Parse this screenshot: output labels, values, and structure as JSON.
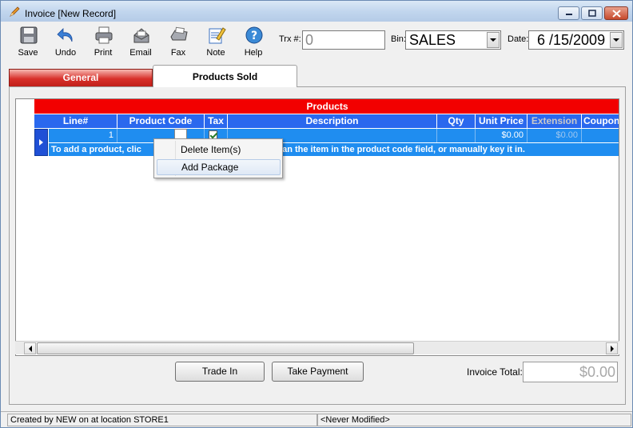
{
  "window": {
    "title": "Invoice [New Record]"
  },
  "toolbar": {
    "buttons": [
      {
        "label": "Save",
        "icon": "floppy-disk-icon"
      },
      {
        "label": "Undo",
        "icon": "undo-arrow-icon"
      },
      {
        "label": "Print",
        "icon": "printer-icon"
      },
      {
        "label": "Email",
        "icon": "email-icon"
      },
      {
        "label": "Fax",
        "icon": "fax-icon"
      },
      {
        "label": "Note",
        "icon": "note-pencil-icon"
      },
      {
        "label": "Help",
        "icon": "help-icon"
      }
    ]
  },
  "header": {
    "trx_label": "Trx #:",
    "trx_value": "0",
    "bin_label": "Bin:",
    "bin_value": "SALES",
    "date_label": "Date:",
    "date_value": "6 /15/2009"
  },
  "tabs": [
    {
      "label": "General",
      "active": false
    },
    {
      "label": "Products Sold",
      "active": true
    }
  ],
  "grid": {
    "band_title": "Products",
    "columns": [
      "Line#",
      "Product Code",
      "Tax",
      "Description",
      "Qty",
      "Unit Price",
      "Extension",
      "Coupon"
    ],
    "row": {
      "line": "1",
      "product_code": "",
      "tax": true,
      "description": "",
      "qty": "",
      "unit_price": "$0.00",
      "extension": "$0.00",
      "coupon": ""
    },
    "hint": "To add a product, click the product code field and scan the item in the product code field, or manually key it in.",
    "hint_left": "To add a product, clic",
    "hint_right": "scan the item in the product code field, or manually key it in."
  },
  "context_menu": {
    "items": [
      "Delete Item(s)",
      "Add Package"
    ]
  },
  "footer": {
    "trade_in_label": "Trade In",
    "take_payment_label": "Take Payment",
    "invoice_total_label": "Invoice Total:",
    "invoice_total_value": "$0.00"
  },
  "status": {
    "left": "Created by NEW on  at location STORE1",
    "right": "<Never Modified>"
  },
  "colors": {
    "band_red": "#f20000",
    "header_blue": "#2a68ee",
    "row_blue": "#1f8df0"
  }
}
